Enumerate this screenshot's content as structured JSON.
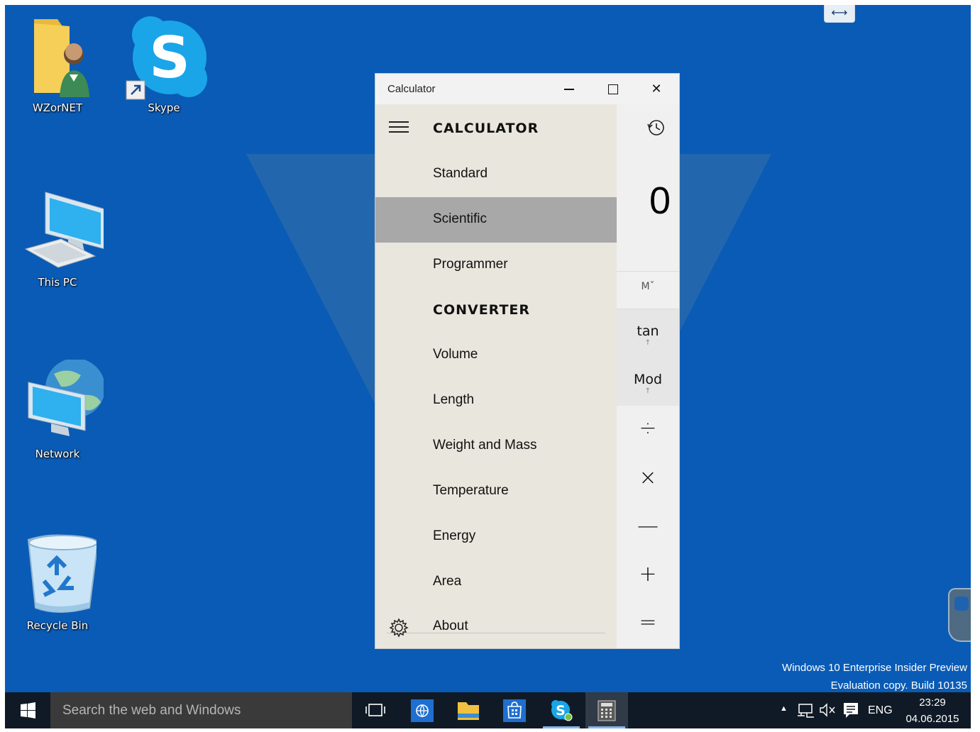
{
  "desktop": {
    "icons": [
      {
        "label": "WZorNET",
        "icon": "user-folder-icon"
      },
      {
        "label": "Skype",
        "icon": "skype-icon"
      },
      {
        "label": "This PC",
        "icon": "computer-icon"
      },
      {
        "label": "Network",
        "icon": "network-globe-icon"
      },
      {
        "label": "Recycle Bin",
        "icon": "recycle-bin-icon"
      }
    ],
    "watermark_line1": "Windows 10 Enterprise Insider Preview",
    "watermark_line2": "Evaluation copy. Build 10135"
  },
  "calculator": {
    "window_title": "Calculator",
    "app_header": "CALCULATOR",
    "display_value": "0",
    "memory_label": "Mˇ",
    "fn_buttons": [
      "tan",
      "Mod"
    ],
    "fn_arrow": "↑",
    "operators": [
      "÷",
      "×",
      "—",
      "+",
      "="
    ],
    "nav": {
      "calculator_items": [
        "Standard",
        "Scientific",
        "Programmer"
      ],
      "selected": "Scientific",
      "converter_header": "CONVERTER",
      "converter_items": [
        "Volume",
        "Length",
        "Weight and Mass",
        "Temperature",
        "Energy",
        "Area"
      ],
      "about_label": "About"
    }
  },
  "taskbar": {
    "search_placeholder": "Search the web and Windows",
    "apps": [
      "task-view-icon",
      "edge-icon",
      "file-explorer-icon",
      "store-icon",
      "skype-icon",
      "calculator-icon"
    ],
    "language": "ENG",
    "time": "23:29",
    "date": "04.06.2015"
  },
  "colors": {
    "desktop": "#0a5bb5",
    "taskbar": "#101a26",
    "nav_selected": "#a8a8a8"
  }
}
